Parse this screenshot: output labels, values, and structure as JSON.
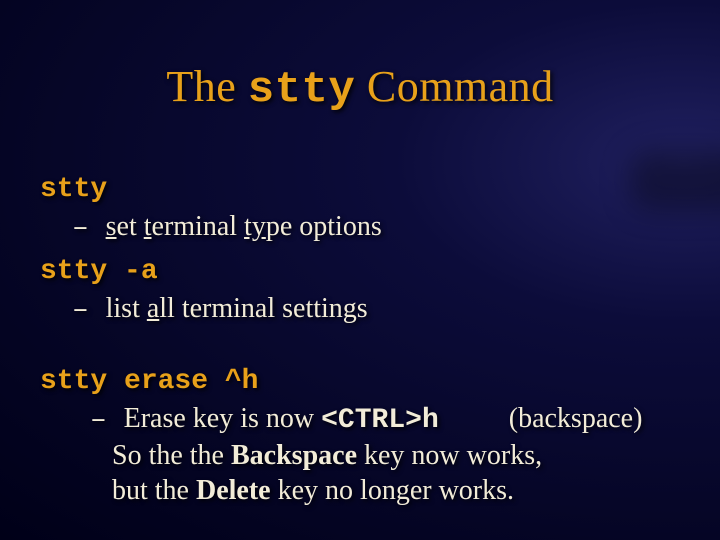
{
  "title": {
    "pre": "The ",
    "cmd": "stty",
    "post": " Command"
  },
  "items": {
    "cmd1": "stty",
    "desc1": {
      "dash": "– ",
      "s": "s",
      "et": "et ",
      "t": "t",
      "erm": "erminal ",
      "ty": "ty",
      "pe": "pe options"
    },
    "cmd2": "stty -a",
    "desc2": {
      "dash": "– ",
      "pre": "list ",
      "a": "a",
      "post": "ll terminal settings"
    },
    "cmd3": "stty erase ^h",
    "desc3": {
      "dash": "– ",
      "l1a": "Erase key is now  ",
      "ctrl": "<CTRL>h",
      "l1b": "(backspace)",
      "l2a": "So the the ",
      "bsp": "Backspace",
      "l2b": " key now works,",
      "l3a": "but the ",
      "del": "Delete",
      "l3b": " key no longer works."
    }
  }
}
